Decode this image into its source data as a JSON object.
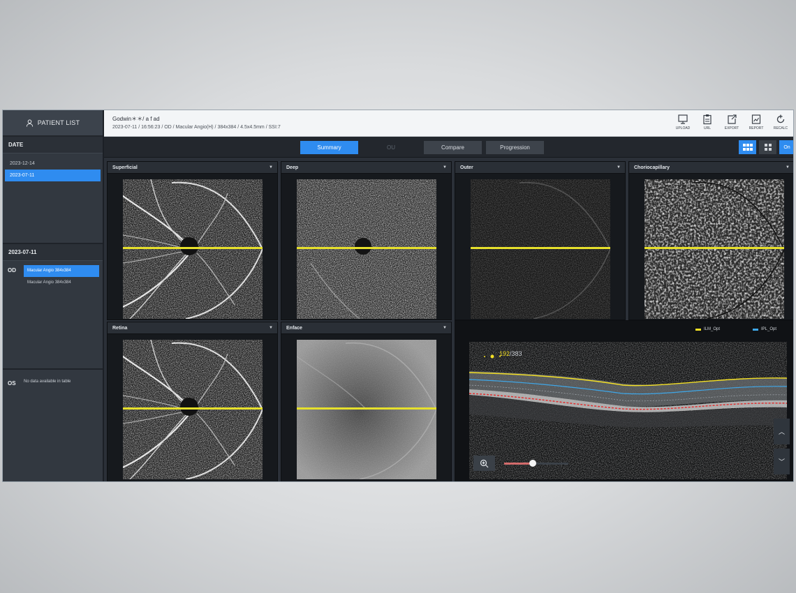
{
  "sidebar": {
    "patient_list_label": "PATIENT LIST",
    "date_header": "DATE",
    "dates": [
      {
        "label": "2023-12-14",
        "selected": false
      },
      {
        "label": "2023-07-11",
        "selected": true
      }
    ],
    "scan_date": "2023-07-11",
    "od": {
      "eye": "OD",
      "scans": [
        {
          "label": "Macular Angio 384x384",
          "selected": true
        },
        {
          "label": "Macular Angio 384x384",
          "selected": false
        }
      ]
    },
    "os": {
      "eye": "OS",
      "message": "No data available in table"
    }
  },
  "header": {
    "patient_line": "Godwin＊＊/ a f ad",
    "scan_info": "2023-07-11 / 16:56:23 / OD / Macular Angio(H) / 384x384 / 4.5x4.5mm / SSI:7",
    "tools": [
      {
        "label": "UPLOAD",
        "icon": "upload-icon"
      },
      {
        "label": "URL",
        "icon": "clipboard-icon"
      },
      {
        "label": "EXPORT",
        "icon": "export-icon"
      },
      {
        "label": "REPORT",
        "icon": "report-icon"
      },
      {
        "label": "RECALC",
        "icon": "recalc-icon"
      }
    ]
  },
  "toolbar": {
    "summary": "Summary",
    "ou": "OU",
    "compare": "Compare",
    "progression": "Progression",
    "on_label": "On"
  },
  "panels": {
    "superficial": "Superficial",
    "deep": "Deep",
    "outer": "Outer",
    "choriocapillary": "Choriocapillary",
    "retina": "Retina",
    "enface": "Enface"
  },
  "bscan": {
    "legend": [
      {
        "label": "ILM_Opt",
        "color": "#f3df25"
      },
      {
        "label": "IPL_Opt",
        "color": "#3fa7e8"
      }
    ],
    "slice_current": "192",
    "slice_total": "/383",
    "zoom_level": 0.45
  },
  "colors": {
    "accent": "#2f8cf0",
    "scanline": "#e6e02c"
  }
}
